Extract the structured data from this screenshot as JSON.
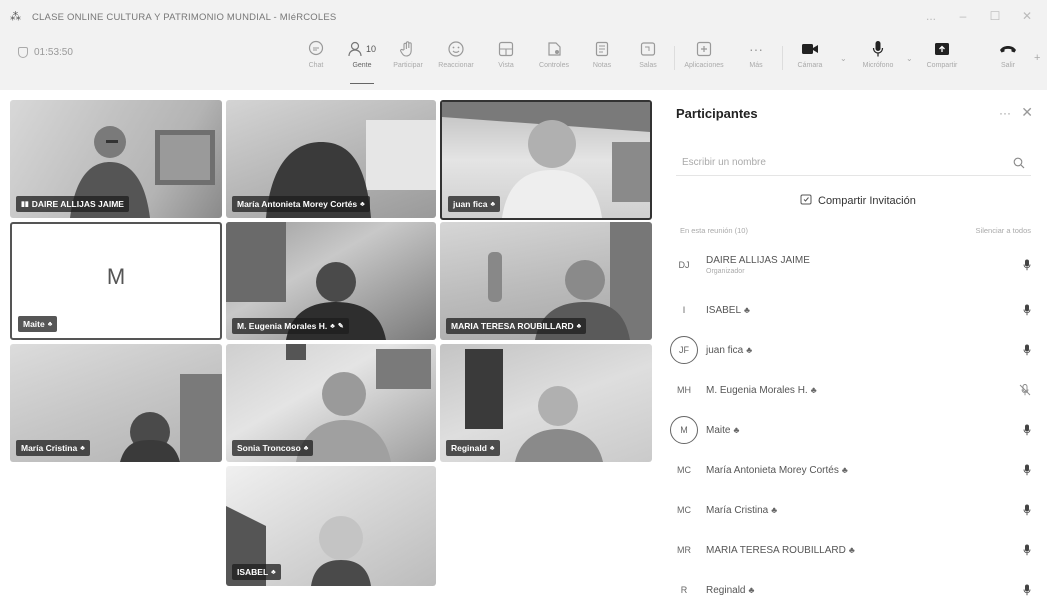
{
  "window": {
    "title": "CLASE ONLINE  CULTURA Y PATRIMONIO MUNDIAL - MIéRCOLES",
    "minimize": "...",
    "restore": "☐",
    "close": "✕"
  },
  "toolbar": {
    "timer": "01:53:50",
    "buttons": [
      {
        "label": "Chat"
      },
      {
        "label": "Gente",
        "count": "10"
      },
      {
        "label": "Participar"
      },
      {
        "label": "Reaccionar"
      },
      {
        "label": "Vista"
      },
      {
        "label": "Controles"
      },
      {
        "label": "Notas"
      },
      {
        "label": "Salas"
      },
      {
        "label": "Aplicaciones"
      },
      {
        "label": "Más"
      },
      {
        "label": "Cámara"
      },
      {
        "label": "Micrófono"
      },
      {
        "label": "Compartir"
      },
      {
        "label": "Salir"
      }
    ]
  },
  "video_tiles": [
    {
      "name": "DAIRE ALLIJAS JAIME"
    },
    {
      "name": "María Antonieta Morey Cortés"
    },
    {
      "name": "juan fica"
    },
    {
      "name": "Maite",
      "initial": "M"
    },
    {
      "name": "M. Eugenia Morales H."
    },
    {
      "name": "MARIA TERESA ROUBILLARD"
    },
    {
      "name": "María Cristina"
    },
    {
      "name": "Sonia Troncoso"
    },
    {
      "name": "Reginald"
    },
    {
      "name": "ISABEL"
    }
  ],
  "panel": {
    "title": "Participantes",
    "more": "···",
    "close": "✕",
    "search_placeholder": "Escribir un nombre",
    "share_label": "Compartir Invitación",
    "section_label": "En esta reunión (10)",
    "silence_all": "Silenciar a todos",
    "participants": [
      {
        "initials": "DJ",
        "name": "DAIRE ALLIJAS JAIME",
        "role": "Organizador"
      },
      {
        "initials": "I",
        "name": "ISABEL"
      },
      {
        "initials": "JF",
        "name": "juan fica"
      },
      {
        "initials": "MH",
        "name": "M. Eugenia Morales H."
      },
      {
        "initials": "M",
        "name": "Maite"
      },
      {
        "initials": "MC",
        "name": "María Antonieta Morey Cortés"
      },
      {
        "initials": "MC",
        "name": "María Cristina"
      },
      {
        "initials": "MR",
        "name": "MARIA TERESA ROUBILLARD"
      },
      {
        "initials": "R",
        "name": "Reginald"
      }
    ]
  }
}
